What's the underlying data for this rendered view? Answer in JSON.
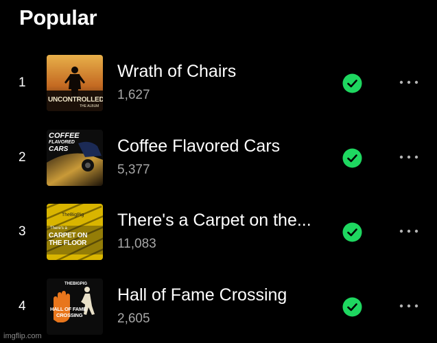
{
  "section_title": "Popular",
  "tracks": [
    {
      "rank": "1",
      "title": "Wrath of Chairs",
      "plays": "1,627",
      "saved_icon": "check-circle-icon",
      "more_icon": "more-dots-icon",
      "art": {
        "subject": "silhouette-figure",
        "text": [
          "UNCONTROLLED",
          "THE ALBUM"
        ]
      }
    },
    {
      "rank": "2",
      "title": "Coffee Flavored Cars",
      "plays": "5,377",
      "saved_icon": "check-circle-icon",
      "more_icon": "more-dots-icon",
      "art": {
        "subject": "car",
        "text": [
          "COFFEE",
          "FLAVORED",
          "CARS"
        ]
      }
    },
    {
      "rank": "3",
      "title": "There's a Carpet on the...",
      "plays": "11,083",
      "saved_icon": "check-circle-icon",
      "more_icon": "more-dots-icon",
      "art": {
        "subject": "yellow-carpet",
        "text": [
          "TheBigPig",
          "There's a",
          "CARPET ON",
          "THE FLOOR"
        ]
      }
    },
    {
      "rank": "4",
      "title": "Hall of Fame Crossing",
      "plays": "2,605",
      "saved_icon": "check-circle-icon",
      "more_icon": "more-dots-icon",
      "art": {
        "subject": "crossing-sign",
        "text": [
          "THEBIGPIG",
          "HALL OF FAME",
          "CROSSING"
        ]
      }
    }
  ],
  "watermark": "imgflip.com",
  "colors": {
    "background": "#000000",
    "accent_green": "#1ed760",
    "secondary_text": "#a7a7a7",
    "dots": "#b3b3b3"
  }
}
